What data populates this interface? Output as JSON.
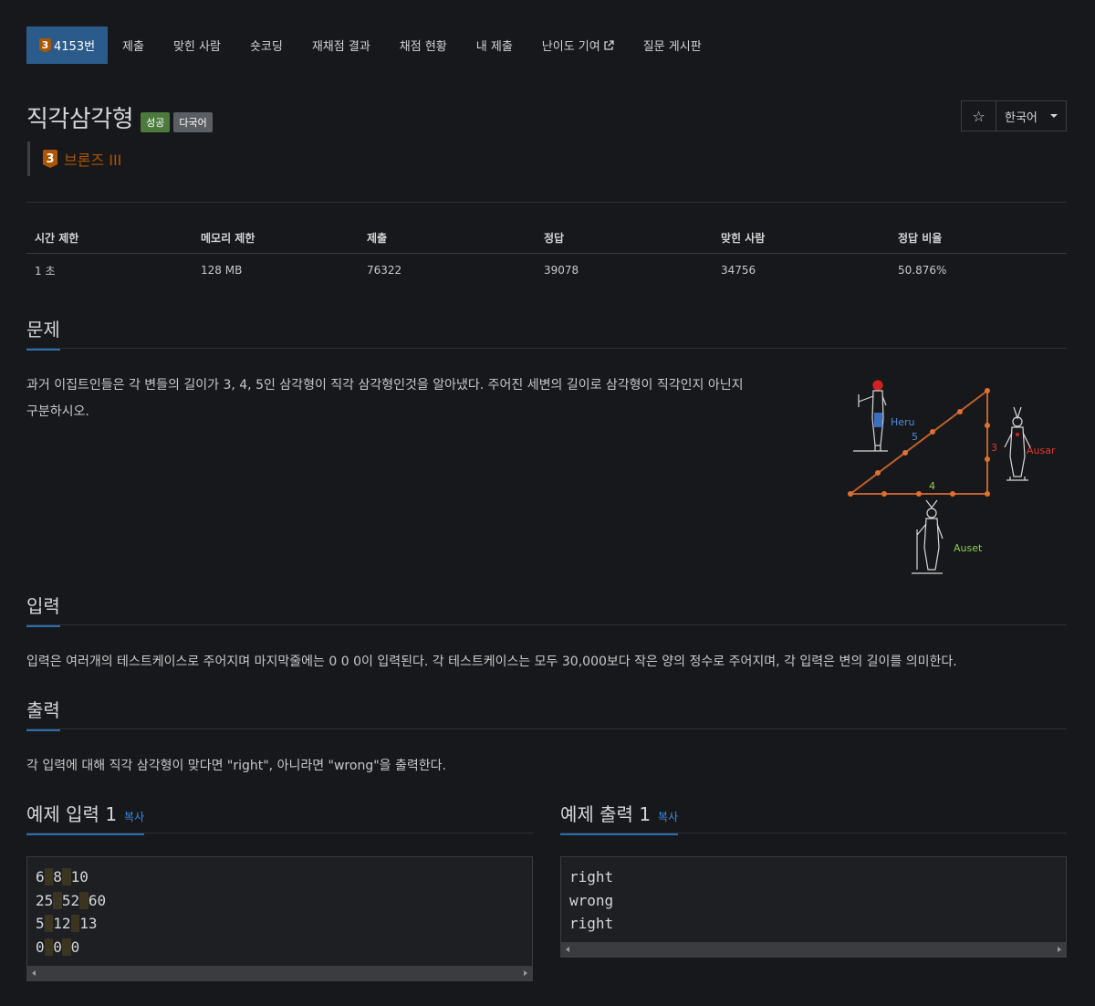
{
  "nav": {
    "problem_tab": "4153번",
    "tier_digit": "3",
    "items": [
      "제출",
      "맞힌 사람",
      "숏코딩",
      "재채점 결과",
      "채점 현황",
      "내 제출",
      "난이도 기여",
      "질문 게시판"
    ]
  },
  "header": {
    "title": "직각삼각형",
    "label_success": "성공",
    "label_multi": "다국어",
    "star": "☆",
    "language": "한국어"
  },
  "tier": {
    "digit": "3",
    "text": "브론즈 III"
  },
  "stats": {
    "headers": [
      "시간 제한",
      "메모리 제한",
      "제출",
      "정답",
      "맞힌 사람",
      "정답 비율"
    ],
    "values": [
      "1 초",
      "128 MB",
      "76322",
      "39078",
      "34756",
      "50.876%"
    ]
  },
  "problem": {
    "heading": "문제",
    "line1": "과거 이집트인들은 각 변들의 길이가 3, 4, 5인 삼각형이 직각 삼각형인것을 알아냈다. 주어진 세변의 길이로 삼각형이 직각인지 아닌지",
    "line2": "구분하시오.",
    "figure": {
      "hypotenuse_label": "5",
      "vertical_label": "3",
      "base_label": "4",
      "name_left": "Heru",
      "name_right": "Ausar",
      "name_bottom": "Auset"
    }
  },
  "input": {
    "heading": "입력",
    "text": "입력은 여러개의 테스트케이스로 주어지며 마지막줄에는 0 0 0이 입력된다. 각 테스트케이스는 모두 30,000보다 작은 양의 정수로 주어지며, 각 입력은 변의 길이를 의미한다."
  },
  "output": {
    "heading": "출력",
    "text": "각 입력에 대해 직각 삼각형이 맞다면 \"right\", 아니라면 \"wrong\"을 출력한다."
  },
  "sample_input": {
    "heading": "예제 입력 1",
    "copy": "복사",
    "lines": [
      [
        "6",
        "8",
        "10"
      ],
      [
        "25",
        "52",
        "60"
      ],
      [
        "5",
        "12",
        "13"
      ],
      [
        "0",
        "0",
        "0"
      ]
    ]
  },
  "sample_output": {
    "heading": "예제 출력 1",
    "copy": "복사",
    "lines": [
      "right",
      "wrong",
      "right"
    ]
  },
  "colors": {
    "background": "#17181b",
    "accent": "#2a5b8a",
    "bronze": "#ad5600",
    "success": "#4c7a3d"
  }
}
